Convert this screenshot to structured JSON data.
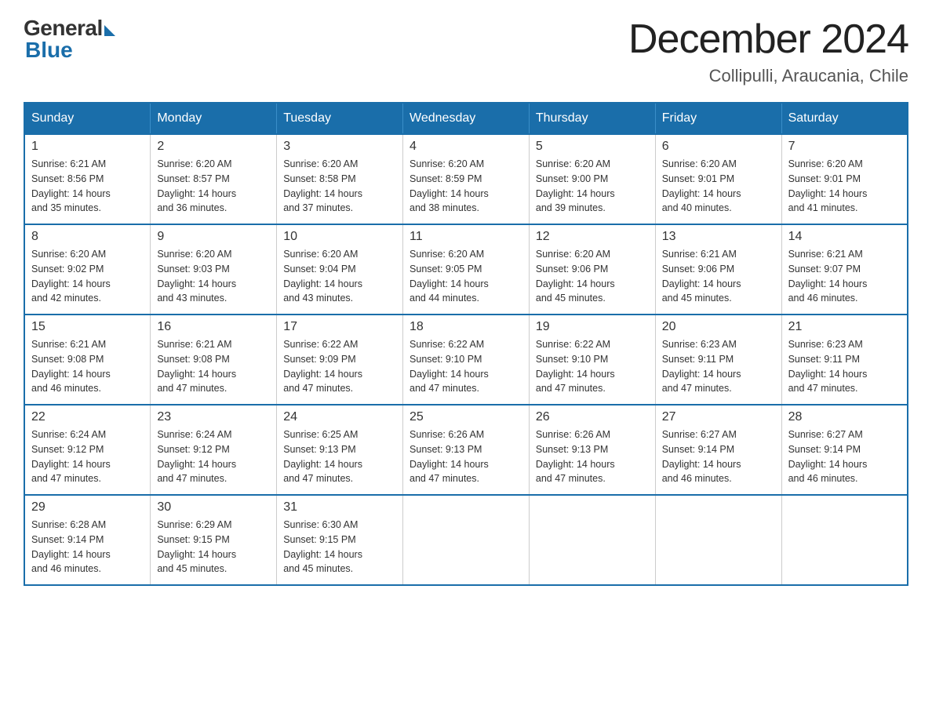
{
  "header": {
    "logo_general": "General",
    "logo_blue": "Blue",
    "month_title": "December 2024",
    "location": "Collipulli, Araucania, Chile"
  },
  "days_of_week": [
    "Sunday",
    "Monday",
    "Tuesday",
    "Wednesday",
    "Thursday",
    "Friday",
    "Saturday"
  ],
  "weeks": [
    [
      {
        "day": "1",
        "sunrise": "6:21 AM",
        "sunset": "8:56 PM",
        "daylight": "14 hours and 35 minutes."
      },
      {
        "day": "2",
        "sunrise": "6:20 AM",
        "sunset": "8:57 PM",
        "daylight": "14 hours and 36 minutes."
      },
      {
        "day": "3",
        "sunrise": "6:20 AM",
        "sunset": "8:58 PM",
        "daylight": "14 hours and 37 minutes."
      },
      {
        "day": "4",
        "sunrise": "6:20 AM",
        "sunset": "8:59 PM",
        "daylight": "14 hours and 38 minutes."
      },
      {
        "day": "5",
        "sunrise": "6:20 AM",
        "sunset": "9:00 PM",
        "daylight": "14 hours and 39 minutes."
      },
      {
        "day": "6",
        "sunrise": "6:20 AM",
        "sunset": "9:01 PM",
        "daylight": "14 hours and 40 minutes."
      },
      {
        "day": "7",
        "sunrise": "6:20 AM",
        "sunset": "9:01 PM",
        "daylight": "14 hours and 41 minutes."
      }
    ],
    [
      {
        "day": "8",
        "sunrise": "6:20 AM",
        "sunset": "9:02 PM",
        "daylight": "14 hours and 42 minutes."
      },
      {
        "day": "9",
        "sunrise": "6:20 AM",
        "sunset": "9:03 PM",
        "daylight": "14 hours and 43 minutes."
      },
      {
        "day": "10",
        "sunrise": "6:20 AM",
        "sunset": "9:04 PM",
        "daylight": "14 hours and 43 minutes."
      },
      {
        "day": "11",
        "sunrise": "6:20 AM",
        "sunset": "9:05 PM",
        "daylight": "14 hours and 44 minutes."
      },
      {
        "day": "12",
        "sunrise": "6:20 AM",
        "sunset": "9:06 PM",
        "daylight": "14 hours and 45 minutes."
      },
      {
        "day": "13",
        "sunrise": "6:21 AM",
        "sunset": "9:06 PM",
        "daylight": "14 hours and 45 minutes."
      },
      {
        "day": "14",
        "sunrise": "6:21 AM",
        "sunset": "9:07 PM",
        "daylight": "14 hours and 46 minutes."
      }
    ],
    [
      {
        "day": "15",
        "sunrise": "6:21 AM",
        "sunset": "9:08 PM",
        "daylight": "14 hours and 46 minutes."
      },
      {
        "day": "16",
        "sunrise": "6:21 AM",
        "sunset": "9:08 PM",
        "daylight": "14 hours and 47 minutes."
      },
      {
        "day": "17",
        "sunrise": "6:22 AM",
        "sunset": "9:09 PM",
        "daylight": "14 hours and 47 minutes."
      },
      {
        "day": "18",
        "sunrise": "6:22 AM",
        "sunset": "9:10 PM",
        "daylight": "14 hours and 47 minutes."
      },
      {
        "day": "19",
        "sunrise": "6:22 AM",
        "sunset": "9:10 PM",
        "daylight": "14 hours and 47 minutes."
      },
      {
        "day": "20",
        "sunrise": "6:23 AM",
        "sunset": "9:11 PM",
        "daylight": "14 hours and 47 minutes."
      },
      {
        "day": "21",
        "sunrise": "6:23 AM",
        "sunset": "9:11 PM",
        "daylight": "14 hours and 47 minutes."
      }
    ],
    [
      {
        "day": "22",
        "sunrise": "6:24 AM",
        "sunset": "9:12 PM",
        "daylight": "14 hours and 47 minutes."
      },
      {
        "day": "23",
        "sunrise": "6:24 AM",
        "sunset": "9:12 PM",
        "daylight": "14 hours and 47 minutes."
      },
      {
        "day": "24",
        "sunrise": "6:25 AM",
        "sunset": "9:13 PM",
        "daylight": "14 hours and 47 minutes."
      },
      {
        "day": "25",
        "sunrise": "6:26 AM",
        "sunset": "9:13 PM",
        "daylight": "14 hours and 47 minutes."
      },
      {
        "day": "26",
        "sunrise": "6:26 AM",
        "sunset": "9:13 PM",
        "daylight": "14 hours and 47 minutes."
      },
      {
        "day": "27",
        "sunrise": "6:27 AM",
        "sunset": "9:14 PM",
        "daylight": "14 hours and 46 minutes."
      },
      {
        "day": "28",
        "sunrise": "6:27 AM",
        "sunset": "9:14 PM",
        "daylight": "14 hours and 46 minutes."
      }
    ],
    [
      {
        "day": "29",
        "sunrise": "6:28 AM",
        "sunset": "9:14 PM",
        "daylight": "14 hours and 46 minutes."
      },
      {
        "day": "30",
        "sunrise": "6:29 AM",
        "sunset": "9:15 PM",
        "daylight": "14 hours and 45 minutes."
      },
      {
        "day": "31",
        "sunrise": "6:30 AM",
        "sunset": "9:15 PM",
        "daylight": "14 hours and 45 minutes."
      },
      null,
      null,
      null,
      null
    ]
  ],
  "labels": {
    "sunrise": "Sunrise:",
    "sunset": "Sunset:",
    "daylight": "Daylight:"
  }
}
